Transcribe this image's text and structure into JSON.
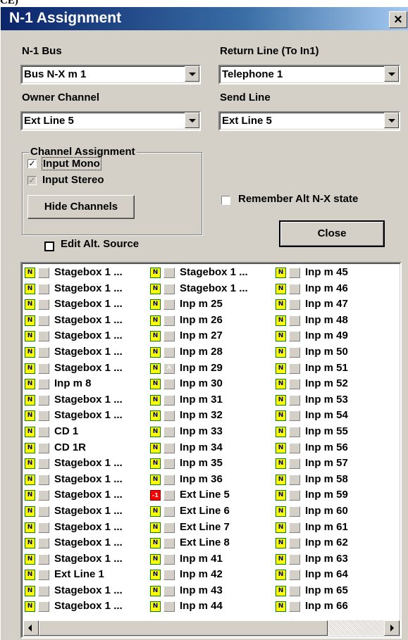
{
  "top_fragment": "CE)",
  "window": {
    "title": "N-1 Assignment",
    "close_glyph": "×"
  },
  "labels": {
    "n1_bus": "N-1 Bus",
    "return_line": "Return Line (To In1)",
    "owner_channel": "Owner Channel",
    "send_line": "Send Line"
  },
  "combos": {
    "n1_bus": "Bus N-X m  1",
    "return_line": "Telephone 1",
    "owner_channel": "Ext Line 5",
    "send_line": "Ext Line 5"
  },
  "channel_assignment": {
    "title": "Channel Assignment",
    "input_mono": {
      "label": "Input Mono",
      "checked": true
    },
    "input_stereo": {
      "label": "Input Stereo",
      "checked": true,
      "disabled": true
    },
    "hide_button": "Hide Channels"
  },
  "remember": {
    "label": "Remember Alt N-X state",
    "checked": false
  },
  "close_button": "Close",
  "edit_alt": {
    "label": "Edit Alt. Source",
    "checked": false
  },
  "colors": {
    "accent_yellow": "#ffff00",
    "badge_red": "#ff0000",
    "title_blue": "#0a246a"
  },
  "channels": {
    "col1": [
      {
        "badge": "N",
        "name": "Stagebox 1 ..."
      },
      {
        "badge": "N",
        "name": "Stagebox 1 ..."
      },
      {
        "badge": "N",
        "name": "Stagebox 1 ..."
      },
      {
        "badge": "N",
        "name": "Stagebox 1 ..."
      },
      {
        "badge": "N",
        "name": "Stagebox 1 ..."
      },
      {
        "badge": "N",
        "name": "Stagebox 1 ..."
      },
      {
        "badge": "N",
        "name": "Stagebox 1 ..."
      },
      {
        "badge": "N",
        "name": "Inp m  8"
      },
      {
        "badge": "N",
        "name": "Stagebox 1 ..."
      },
      {
        "badge": "N",
        "name": "Stagebox 1 ..."
      },
      {
        "badge": "N",
        "name": "CD 1"
      },
      {
        "badge": "N",
        "name": "CD 1R"
      },
      {
        "badge": "N",
        "name": "Stagebox 1 ..."
      },
      {
        "badge": "N",
        "name": "Stagebox 1 ..."
      },
      {
        "badge": "N",
        "name": "Stagebox 1 ..."
      },
      {
        "badge": "N",
        "name": "Stagebox 1 ..."
      },
      {
        "badge": "N",
        "name": "Stagebox 1 ..."
      },
      {
        "badge": "N",
        "name": "Stagebox 1 ..."
      },
      {
        "badge": "N",
        "name": "Stagebox 1 ..."
      },
      {
        "badge": "N",
        "name": "Ext Line 1"
      },
      {
        "badge": "N",
        "name": "Stagebox 1 ..."
      },
      {
        "badge": "N",
        "name": "Stagebox 1 ..."
      }
    ],
    "col2": [
      {
        "badge": "N",
        "name": "Stagebox 1 ..."
      },
      {
        "badge": "N",
        "name": "Stagebox 1 ..."
      },
      {
        "badge": "N",
        "name": "Inp m 25"
      },
      {
        "badge": "N",
        "name": "Inp m 26"
      },
      {
        "badge": "N",
        "name": "Inp m 27"
      },
      {
        "badge": "N",
        "name": "Inp m 28"
      },
      {
        "badge": "N",
        "name": "Inp m 29",
        "box": "A"
      },
      {
        "badge": "N",
        "name": "Inp m 30"
      },
      {
        "badge": "N",
        "name": "Inp m 31"
      },
      {
        "badge": "N",
        "name": "Inp m 32"
      },
      {
        "badge": "N",
        "name": "Inp m 33"
      },
      {
        "badge": "N",
        "name": "Inp m 34"
      },
      {
        "badge": "N",
        "name": "Inp m 35"
      },
      {
        "badge": "N",
        "name": "Inp m 36"
      },
      {
        "badge": "-1",
        "name": "Ext Line 5",
        "red": true
      },
      {
        "badge": "N",
        "name": "Ext Line 6"
      },
      {
        "badge": "N",
        "name": "Ext Line 7"
      },
      {
        "badge": "N",
        "name": "Ext Line 8"
      },
      {
        "badge": "N",
        "name": "Inp m 41"
      },
      {
        "badge": "N",
        "name": "Inp m 42"
      },
      {
        "badge": "N",
        "name": "Inp m 43"
      },
      {
        "badge": "N",
        "name": "Inp m 44"
      }
    ],
    "col3": [
      {
        "badge": "N",
        "name": "Inp m 45"
      },
      {
        "badge": "N",
        "name": "Inp m 46"
      },
      {
        "badge": "N",
        "name": "Inp m 47"
      },
      {
        "badge": "N",
        "name": "Inp m 48"
      },
      {
        "badge": "N",
        "name": "Inp m 49"
      },
      {
        "badge": "N",
        "name": "Inp m 50"
      },
      {
        "badge": "N",
        "name": "Inp m 51"
      },
      {
        "badge": "N",
        "name": "Inp m 52"
      },
      {
        "badge": "N",
        "name": "Inp m 53"
      },
      {
        "badge": "N",
        "name": "Inp m 54"
      },
      {
        "badge": "N",
        "name": "Inp m 55"
      },
      {
        "badge": "N",
        "name": "Inp m 56"
      },
      {
        "badge": "N",
        "name": "Inp m 57"
      },
      {
        "badge": "N",
        "name": "Inp m 58"
      },
      {
        "badge": "N",
        "name": "Inp m 59"
      },
      {
        "badge": "N",
        "name": "Inp m 60"
      },
      {
        "badge": "N",
        "name": "Inp m 61"
      },
      {
        "badge": "N",
        "name": "Inp m 62"
      },
      {
        "badge": "N",
        "name": "Inp m 63"
      },
      {
        "badge": "N",
        "name": "Inp m 64"
      },
      {
        "badge": "N",
        "name": "Inp m 65"
      },
      {
        "badge": "N",
        "name": "Inp m 66"
      }
    ]
  }
}
